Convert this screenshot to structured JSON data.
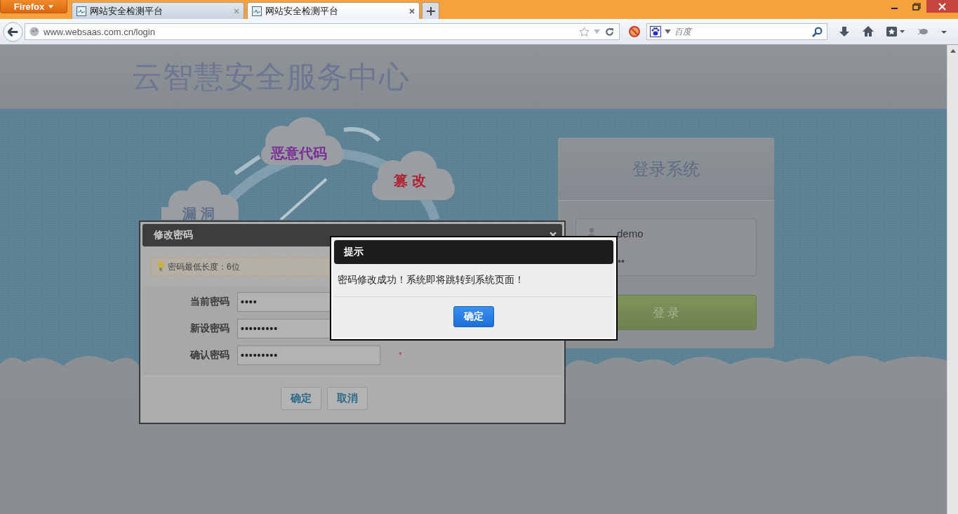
{
  "browser": {
    "menu_button": "Firefox",
    "tabs": [
      {
        "title": "网站安全检测平台",
        "selected": false
      },
      {
        "title": "网站安全检测平台",
        "selected": true
      }
    ],
    "address": "www.websaas.com.cn/login",
    "search": {
      "placeholder": "百度"
    }
  },
  "page": {
    "site_title": "云智慧安全服务中心",
    "illustration_labels": [
      {
        "text": "恶意代码",
        "color": "#7a2f96"
      },
      {
        "text": "篡 改",
        "color": "#b0202f"
      },
      {
        "text": "漏 洞",
        "color": "#5d7088"
      }
    ]
  },
  "login": {
    "title": "登录系统",
    "username": "demo",
    "password_visible": "••",
    "button": "登 录"
  },
  "password_dialog": {
    "title": "修改密码",
    "tip": "密码最低长度：6位",
    "fields": [
      {
        "label": "当前密码",
        "value": "••••"
      },
      {
        "label": "新设密码",
        "value": "•••••••••"
      },
      {
        "label": "确认密码",
        "value": "•••••••••",
        "mark": "*"
      }
    ],
    "buttons": [
      "确定",
      "取消"
    ]
  },
  "alert": {
    "title": "提示",
    "message": "密码修改成功！系统即将跳转到系统页面！",
    "button": "确定"
  }
}
